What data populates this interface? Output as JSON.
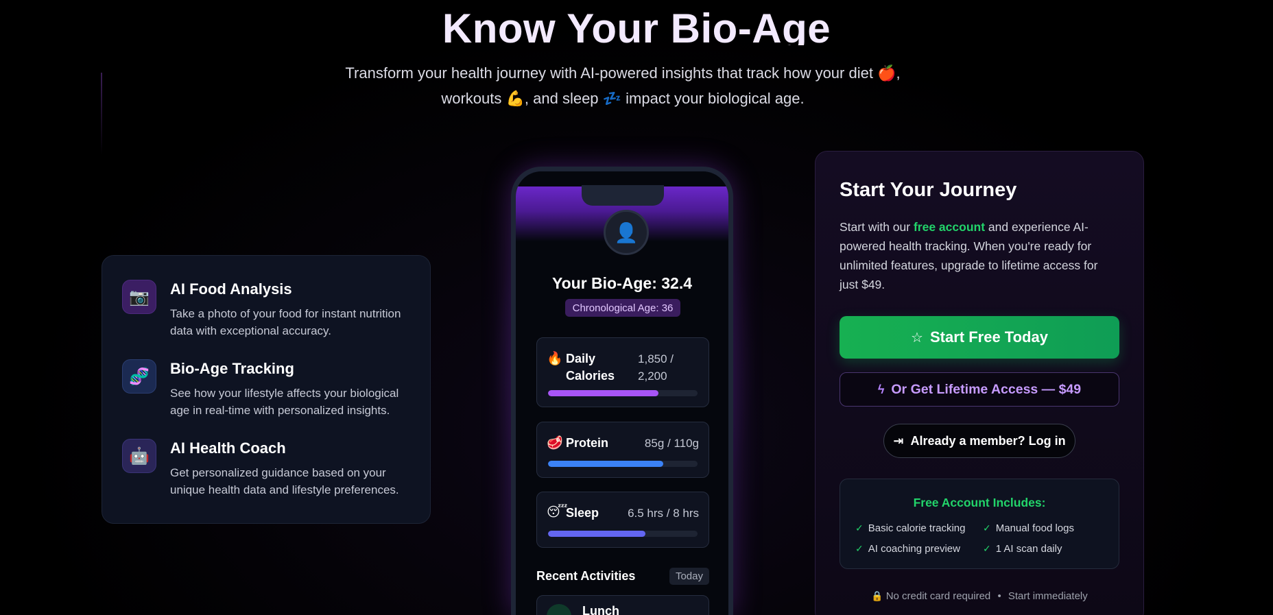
{
  "hero": {
    "title": "Know Your Bio-Age",
    "subtitle_line1": "Transform your health journey with AI-powered insights that track how your diet 🍎,",
    "subtitle_line2": "workouts 💪, and sleep 💤 impact your biological age."
  },
  "features": [
    {
      "icon": "camera-icon",
      "glyph": "📷",
      "title": "AI Food Analysis",
      "description": "Take a photo of your food for instant nutrition data with exceptional accuracy."
    },
    {
      "icon": "dna-icon",
      "glyph": "🧬",
      "title": "Bio-Age Tracking",
      "description": "See how your lifestyle affects your biological age in real-time with personalized insights."
    },
    {
      "icon": "robot-icon",
      "glyph": "🤖",
      "title": "AI Health Coach",
      "description": "Get personalized guidance based on your unique health data and lifestyle preferences."
    }
  ],
  "phone": {
    "avatar_glyph": "👤",
    "bio_age": "Your Bio-Age: 32.4",
    "chronological": "Chronological Age: 36",
    "stats": [
      {
        "glyph": "🔥",
        "name_line1": "Daily",
        "name_line2": "Calories",
        "value_line1": "1,850 /",
        "value_line2": "2,200",
        "progress": 0.74,
        "color": "#a855f7"
      },
      {
        "glyph": "🥩",
        "name": "Protein",
        "value": "85g / 110g",
        "progress": 0.77,
        "color": "#3b82f6"
      },
      {
        "glyph": "😴",
        "name": "Sleep",
        "value": "6.5 hrs / 8 hrs",
        "progress": 0.65,
        "color": "#6366f1"
      }
    ],
    "recent_title": "Recent Activities",
    "recent_badge": "Today",
    "recent_first": "Lunch"
  },
  "journey": {
    "title": "Start Your Journey",
    "text_before": "Start with our ",
    "text_highlight": "free account",
    "text_after": " and experience AI-powered health tracking. When you're ready for unlimited features, upgrade to lifetime access for just $49.",
    "free_button": "Start Free Today",
    "lifetime_button": "Or Get Lifetime Access — $49",
    "login_button": "Already a member? Log in",
    "includes_title": "Free Account Includes:",
    "includes": [
      "Basic calorie tracking",
      "Manual food logs",
      "AI coaching preview",
      "1 AI scan daily"
    ],
    "footnote_left": "No credit card required",
    "footnote_sep": "•",
    "footnote_right": "Start immediately"
  },
  "colors": {
    "accent_green": "#22d46a",
    "accent_purple": "#c79bff",
    "title_color": "#f3eaff"
  }
}
